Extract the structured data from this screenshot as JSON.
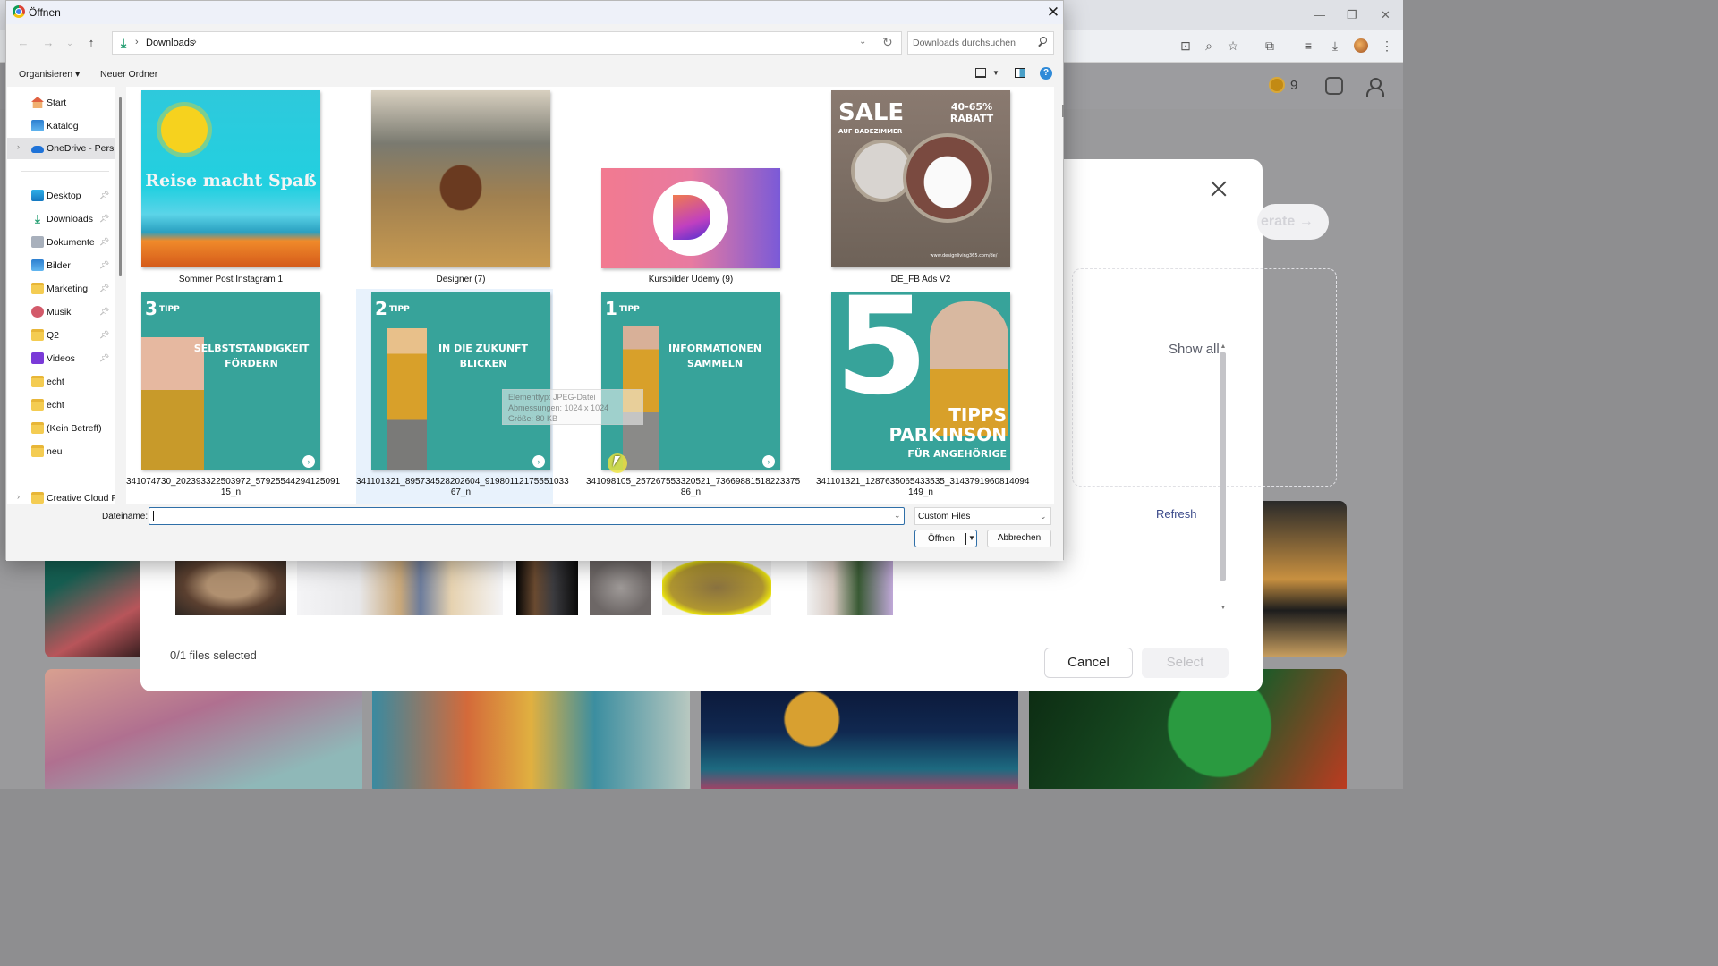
{
  "dialog": {
    "title": "Öffnen",
    "close_icon": "close-icon",
    "breadcrumb": [
      "Downloads"
    ],
    "search_placeholder": "Downloads durchsuchen",
    "commands": {
      "organize": "Organisieren ▾",
      "new_folder": "Neuer Ordner"
    },
    "sidebar": {
      "pinned_top": [
        {
          "label": "Start",
          "icon": "home-icon"
        },
        {
          "label": "Katalog",
          "icon": "gallery-icon"
        },
        {
          "label": "OneDrive - Pers",
          "icon": "onedrive-icon",
          "selected": true
        }
      ],
      "quick_access": [
        {
          "label": "Desktop",
          "icon": "desktop-icon",
          "pinned": true
        },
        {
          "label": "Downloads",
          "icon": "download-icon",
          "pinned": true
        },
        {
          "label": "Dokumente",
          "icon": "documents-icon",
          "pinned": true
        },
        {
          "label": "Bilder",
          "icon": "pictures-icon",
          "pinned": true
        },
        {
          "label": "Marketing",
          "icon": "folder-icon",
          "pinned": true
        },
        {
          "label": "Musik",
          "icon": "music-icon",
          "pinned": true
        },
        {
          "label": "Q2",
          "icon": "folder-icon",
          "pinned": true
        },
        {
          "label": "Videos",
          "icon": "videos-icon",
          "pinned": true
        },
        {
          "label": "echt",
          "icon": "folder-icon",
          "pinned": false
        },
        {
          "label": "echt",
          "icon": "folder-icon",
          "pinned": false
        },
        {
          "label": "(Kein Betreff)",
          "icon": "folder-icon",
          "pinned": false
        },
        {
          "label": "neu",
          "icon": "folder-icon",
          "pinned": false
        }
      ],
      "bottom": {
        "label": "Creative Cloud F",
        "icon": "folder-icon"
      }
    },
    "files": [
      {
        "name": "Sommer Post Instagram 1",
        "thumb_text": "Reise macht Spaß"
      },
      {
        "name": "Designer (7)",
        "thumb_text": ""
      },
      {
        "name": "Kursbilder Udemy (9)",
        "thumb_text": ""
      },
      {
        "name": "DE_FB Ads V2",
        "thumb_text": "SALE",
        "thumb_sub": "40-65% RABATT",
        "thumb_small": "AUF BADEZIMMER",
        "thumb_url": "www.designliving365.com/de/"
      },
      {
        "name": "341074730_202393322503972_579255442941250915_n",
        "name_line1": "341074730_202393322503972_57925544294125091",
        "name_line2": "15_n",
        "tipp_num": "3",
        "tipp": "TIPP",
        "headline": "SELBSTSTÄNDIGKEIT FÖRDERN"
      },
      {
        "name": "341101321_895734528202604_919801121755510336 7_n",
        "name_line1": "341101321_895734528202604_91980112175551033",
        "name_line2": "67_n",
        "tipp_num": "2",
        "tipp": "TIPP",
        "headline": "IN DIE ZUKUNFT BLICKEN",
        "hovered": true
      },
      {
        "name": "341098105_257267553320521_736698815182233758 6_n",
        "name_line1": "341098105_257267553320521_73669881518223375",
        "name_line2": "86_n",
        "tipp_num": "1",
        "tipp": "TIPP",
        "headline": "INFORMATIONEN SAMMELN"
      },
      {
        "name": "341101321_1287635065433535_3143791960814094149_n",
        "name_line1": "341101321_1287635065433535_3143791960814094",
        "name_line2": "149_n",
        "big_num": "5",
        "headline": "TIPPS PARKINSON",
        "sub": "FÜR ANGEHÖRIGE"
      }
    ],
    "tooltip": {
      "type": "Elementtyp: JPEG-Datei",
      "dimensions": "Abmessungen: 1024 x 1024",
      "size": "Größe: 80 KB"
    },
    "filename_label": "Dateiname:",
    "filename_value": "",
    "filetype_selected": "Custom Files",
    "open_button": "Öffnen",
    "cancel_button": "Abbrechen"
  },
  "background_modal": {
    "show_all": "Show all",
    "refresh": "Refresh",
    "generate_ghost": "erate →",
    "files_selected": "0/1 files selected",
    "cancel": "Cancel",
    "select": "Select"
  },
  "background_app": {
    "coin_count": "9"
  }
}
